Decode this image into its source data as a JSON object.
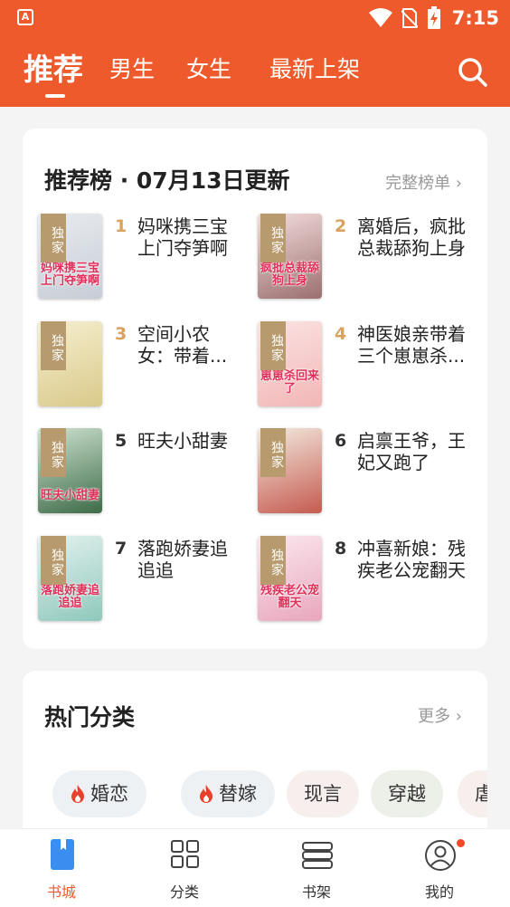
{
  "status_bar": {
    "app_icon_letter": "A",
    "time": "7:15"
  },
  "top_tabs": [
    "推荐",
    "男生",
    "女生",
    "最新上架"
  ],
  "ranking": {
    "title": "推荐榜 · 07月13日更新",
    "more": "完整榜单 ›",
    "books": [
      {
        "rank": "1",
        "title": "妈咪携三宝上门夺笋啊",
        "line1": "妈咪携三宝",
        "line2": "上门夺笋啊",
        "badge": "独家",
        "cover_text": "妈咪携三宝上门夺笋啊",
        "cover_colors": [
          "#e8ecef",
          "#c7cdd6"
        ]
      },
      {
        "rank": "2",
        "title": "离婚后，疯批总裁舔狗上身",
        "line1": "离婚后，疯批",
        "line2": "总裁舔狗上身",
        "badge": "独家",
        "cover_text": "疯批总裁舔狗上身",
        "cover_colors": [
          "#f3dedd",
          "#9c6f70"
        ]
      },
      {
        "rank": "3",
        "title": "空间小农女：带着...",
        "line1": "空间小农",
        "line2": "女：带着...",
        "badge": "独家",
        "cover_text": "",
        "cover_colors": [
          "#f6efcf",
          "#d9c98a"
        ]
      },
      {
        "rank": "4",
        "title": "神医娘亲带着三个崽崽杀...",
        "line1": "神医娘亲带着",
        "line2": "三个崽崽杀...",
        "badge": "独家",
        "cover_text": "崽崽杀回来了",
        "cover_colors": [
          "#fbe3e3",
          "#f2b6b6"
        ]
      },
      {
        "rank": "5",
        "title": "旺夫小甜妻",
        "line1": "旺夫小甜妻",
        "line2": "",
        "badge": "独家",
        "cover_text": "旺夫小甜妻",
        "cover_colors": [
          "#cfe3d2",
          "#3d6b47"
        ]
      },
      {
        "rank": "6",
        "title": "启禀王爷，王妃又跑了",
        "line1": "启禀王爷，王",
        "line2": "妃又跑了",
        "badge": "独家",
        "cover_text": "",
        "cover_colors": [
          "#f4ece1",
          "#c55a4f"
        ]
      },
      {
        "rank": "7",
        "title": "落跑娇妻追追追",
        "line1": "落跑娇妻追",
        "line2": "追追",
        "badge": "独家",
        "cover_text": "落跑娇妻追追追",
        "cover_colors": [
          "#e3f1ee",
          "#8fc8bc"
        ]
      },
      {
        "rank": "8",
        "title": "冲喜新娘：残疾老公宠翻天",
        "line1": "冲喜新娘：残",
        "line2": "疾老公宠翻天",
        "badge": "独家",
        "cover_text": "残疾老公宠翻天",
        "cover_colors": [
          "#fbe8ee",
          "#e8a6bd"
        ]
      }
    ]
  },
  "categories": {
    "title": "热门分类",
    "more": "更多 ›",
    "chips": [
      {
        "label": "婚恋",
        "hot": true,
        "bg": "#eef1f4"
      },
      {
        "label": "替嫁",
        "hot": true,
        "bg": "#eef1f4"
      },
      {
        "label": "现言",
        "hot": false,
        "bg": "#f7efee"
      },
      {
        "label": "穿越",
        "hot": false,
        "bg": "#edefe9"
      },
      {
        "label": "虐恋",
        "hot": false,
        "bg": "#f7efee"
      }
    ]
  },
  "bottom_nav": [
    {
      "label": "书城",
      "icon": "bookstore-icon",
      "active": true
    },
    {
      "label": "分类",
      "icon": "category-grid-icon",
      "active": false
    },
    {
      "label": "书架",
      "icon": "bookshelf-icon",
      "active": false
    },
    {
      "label": "我的",
      "icon": "profile-icon",
      "active": false,
      "has_dot": true
    }
  ],
  "colors": {
    "brand": "#ee5a2b",
    "rank_top": "#d9a35f",
    "rank_other": "#333333",
    "badge": "#b79a6e"
  }
}
